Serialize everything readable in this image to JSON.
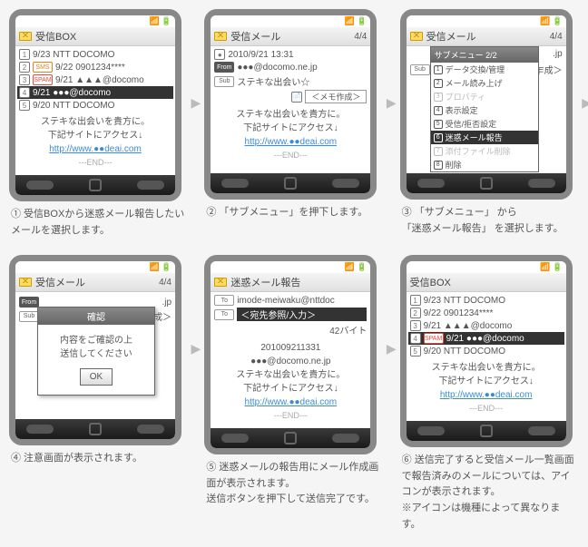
{
  "status": {
    "signal": "📶",
    "bat": "🔋"
  },
  "screens": [
    {
      "title": "受信BOX",
      "counter": "",
      "rows": [
        {
          "n": "1",
          "badge": "",
          "txt": "9/23 NTT DOCOMO"
        },
        {
          "n": "2",
          "badge": "SMS",
          "txt": "9/22 0901234****"
        },
        {
          "n": "3",
          "badge": "SPAM",
          "txt": "9/21 ▲▲▲@docomo"
        },
        {
          "n": "4",
          "badge": "",
          "txt": "9/21 ●●●@docomo",
          "sel": true
        },
        {
          "n": "5",
          "badge": "",
          "txt": "9/20 NTT DOCOMO"
        }
      ],
      "body": [
        "ステキな出会いを貴方に。",
        "下記サイトにアクセス↓"
      ],
      "link": "http://www.●●deai.com",
      "end": "---END---",
      "caption_num": "①",
      "caption": "受信BOXから迷惑メール報告したいメールを選択します。",
      "arrow": true
    },
    {
      "title": "受信メール",
      "counter": "4/4",
      "detail": {
        "date": "2010/9/21 13:31",
        "from": "●●●@docomo.ne.jp",
        "sub": "ステキな出会い☆",
        "memo": "＜メモ作成＞"
      },
      "body": [
        "ステキな出会いを貴方に。",
        "下記サイトにアクセス↓"
      ],
      "link": "http://www.●●deai.com",
      "end": "---END---",
      "caption_num": "②",
      "caption": "「サブメニュー」を押下します。",
      "arrow": true
    },
    {
      "title": "受信メール",
      "counter": "4/4",
      "submenu": {
        "title": "サブメニュー 2/2",
        "items": [
          {
            "n": "1",
            "txt": "データ交換/管理"
          },
          {
            "n": "2",
            "txt": "メール読み上げ"
          },
          {
            "n": "3",
            "txt": "プロパティ",
            "dis": true
          },
          {
            "n": "4",
            "txt": "表示設定"
          },
          {
            "n": "5",
            "txt": "受信/拒否設定"
          },
          {
            "n": "6",
            "txt": "迷惑メール報告",
            "sel": true
          },
          {
            "n": "7",
            "txt": "添付ファイル削除",
            "dis": true
          },
          {
            "n": "8",
            "txt": "削除"
          }
        ]
      },
      "bg_rows": [
        {
          "badge": "",
          "txt": ".jp"
        },
        {
          "badge": "",
          "txt": ""
        },
        {
          "badge": "Sub",
          "txt": "乍成＞"
        }
      ],
      "caption_num": "③",
      "caption": "「サブメニュー」 から\n「迷惑メール報告」 を選択します。",
      "arrow": true
    },
    {
      "title": "受信メール",
      "counter": "4/4",
      "dialog": {
        "title": "確認",
        "body": "内容をご確認の上\n送信してください",
        "ok": "OK"
      },
      "bg_rows": [
        {
          "badge": "",
          "txt": ""
        },
        {
          "badge": "From",
          "txt": ".jp"
        },
        {
          "badge": "Sub",
          "txt": "乍成＞"
        }
      ],
      "caption_num": "④",
      "caption": "注意画面が表示されます。",
      "arrow": true
    },
    {
      "title": "迷惑メール報告",
      "counter": "",
      "report": {
        "to": "imode-meiwaku@nttdoc",
        "to2": "＜宛先参照/入力＞",
        "size": "42バイト",
        "id": "201009211331",
        "from": "●●●@docomo.ne.jp"
      },
      "body": [
        "ステキな出会いを貴方に。",
        "下記サイトにアクセス↓"
      ],
      "link": "http://www.●●deai.com",
      "end": "---END---",
      "caption_num": "⑤",
      "caption": "迷惑メールの報告用にメール作成画面が表示されます。\n送信ボタンを押下して送信完了です。",
      "arrow": true
    },
    {
      "title": "受信BOX",
      "counter": "",
      "rows": [
        {
          "n": "1",
          "badge": "",
          "txt": "9/23 NTT DOCOMO"
        },
        {
          "n": "2",
          "badge": "",
          "txt": "9/22 0901234****"
        },
        {
          "n": "3",
          "badge": "",
          "txt": "9/21 ▲▲▲@docomo"
        },
        {
          "n": "4",
          "badge": "SPAM",
          "txt": "9/21 ●●●@docomo",
          "sel": true
        },
        {
          "n": "5",
          "badge": "",
          "txt": "9/20 NTT DOCOMO"
        }
      ],
      "body": [
        "ステキな出会いを貴方に。",
        "下記サイトにアクセス↓"
      ],
      "link": "http://www.●●deai.com",
      "end": "---END---",
      "caption_num": "⑥",
      "caption": "送信完了すると受信メール一覧画面で報告済みのメールについては、アイコンが表示されます。\n※アイコンは機種によって異なります。",
      "arrow": false
    }
  ]
}
